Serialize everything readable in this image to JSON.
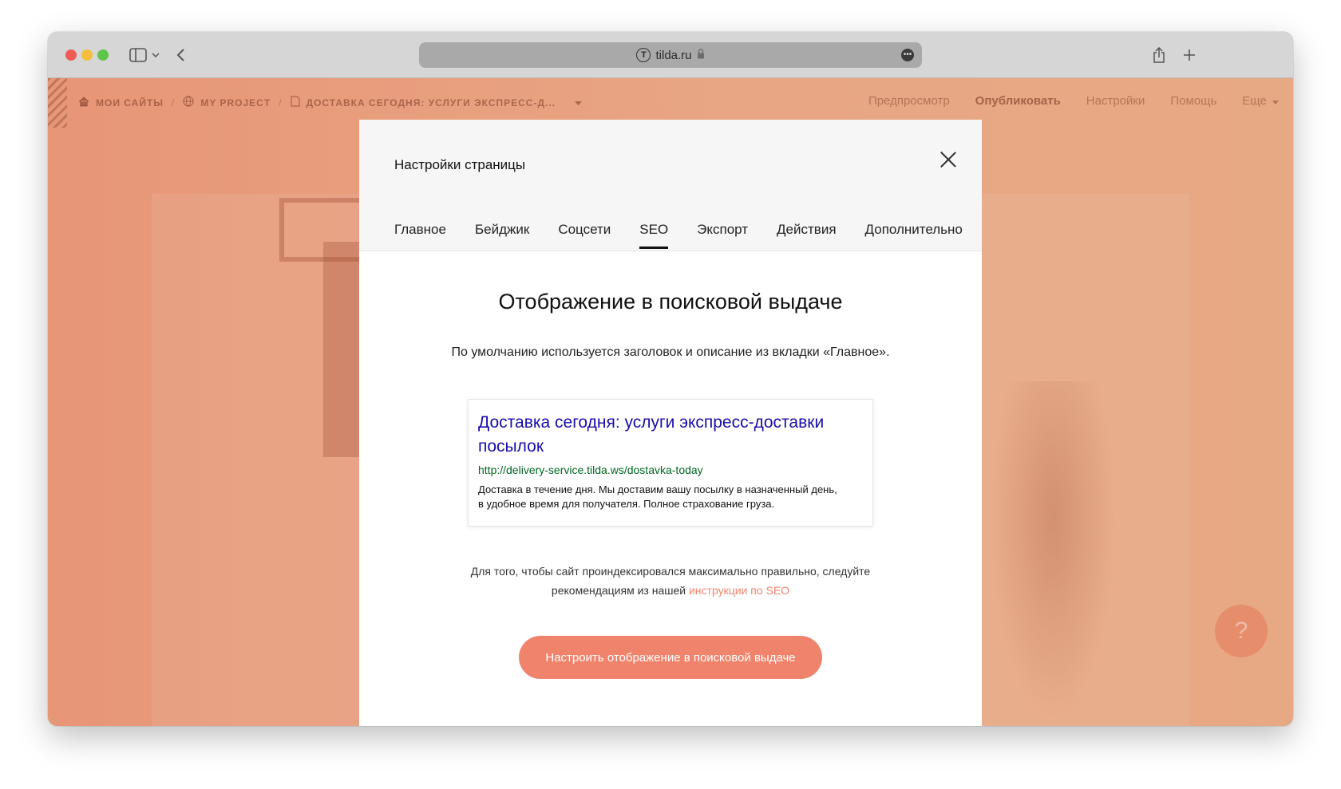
{
  "browser": {
    "url": "tilda.ru",
    "icons": [
      "sidebar-icon",
      "chevron-down-icon",
      "back-icon",
      "lock-icon",
      "more-icon",
      "share-icon",
      "new-tab-icon"
    ]
  },
  "tilda_bar": {
    "breadcrumbs": [
      {
        "label": "МОИ САЙТЫ",
        "icon": "home-icon"
      },
      {
        "label": "MY PROJECT",
        "icon": "globe-icon"
      },
      {
        "label": "ДОСТАВКА СЕГОДНЯ: УСЛУГИ ЭКСПРЕСС-Д...",
        "icon": "page-icon"
      }
    ],
    "actions": {
      "preview": "Предпросмотр",
      "publish": "Опубликовать",
      "settings": "Настройки",
      "help": "Помощь",
      "more": "Еще"
    }
  },
  "modal": {
    "title": "Настройки страницы",
    "tabs": [
      "Главное",
      "Бейджик",
      "Соцсети",
      "SEO",
      "Экспорт",
      "Действия",
      "Дополнительно"
    ],
    "active_tab": "SEO",
    "heading": "Отображение в поисковой выдаче",
    "subtitle": "По умолчанию используется заголовок и описание из вкладки «Главное».",
    "snippet": {
      "title": "Доставка сегодня: услуги экспресс-доставки посылок",
      "url": "http://delivery-service.tilda.ws/dostavka-today",
      "description": "Доставка в течение дня. Мы доставим вашу посылку в назначенный день, в удобное время для получателя. Полное страхование груза."
    },
    "note_text": "Для того, чтобы сайт проиндексировался максимально правильно, следуйте рекомендациям из нашей",
    "note_link": "инструкции по SEO",
    "cta_label": "Настроить отображение в поисковой выдаче"
  },
  "help_button": "?",
  "colors": {
    "accent": "#f0836c",
    "link": "#1a0dab",
    "url": "#006621"
  }
}
